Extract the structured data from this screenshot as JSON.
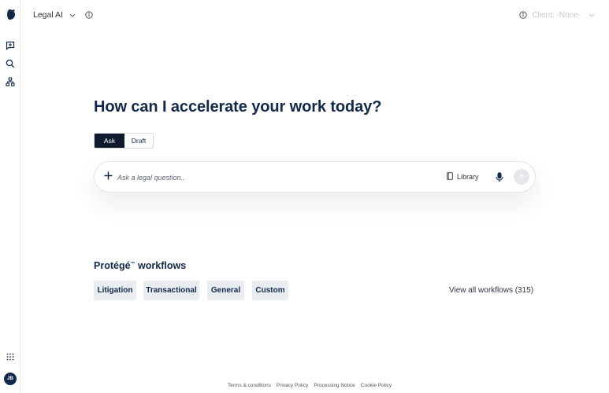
{
  "header": {
    "app_title": "Legal AI",
    "client_label": "Client: -None-"
  },
  "main": {
    "headline": "How can I accelerate your work today?",
    "mode_tabs": [
      {
        "label": "Ask",
        "active": true
      },
      {
        "label": "Draft",
        "active": false
      }
    ],
    "input": {
      "placeholder": "Ask a legal question..",
      "value": ""
    },
    "library_label": "Library",
    "workflows": {
      "title": "Protégé",
      "title_mark": "™",
      "title_suffix": " workflows",
      "items": [
        "Litigation",
        "Transactional",
        "General",
        "Custom"
      ],
      "view_all": "View all workflows (315)"
    }
  },
  "sidebar": {
    "avatar_initials": "JB",
    "icons": [
      "new-chat-icon",
      "search-icon",
      "workflow-hierarchy-icon",
      "apps-grid-icon"
    ]
  },
  "footer": {
    "links": [
      "Terms & conditions",
      "Privacy Policy",
      "Processing Notice",
      "Cookie Policy"
    ]
  },
  "colors": {
    "brand_navy": "#13294b",
    "active_tab": "#0f1b2d",
    "chip_bg": "#e9edf1"
  }
}
